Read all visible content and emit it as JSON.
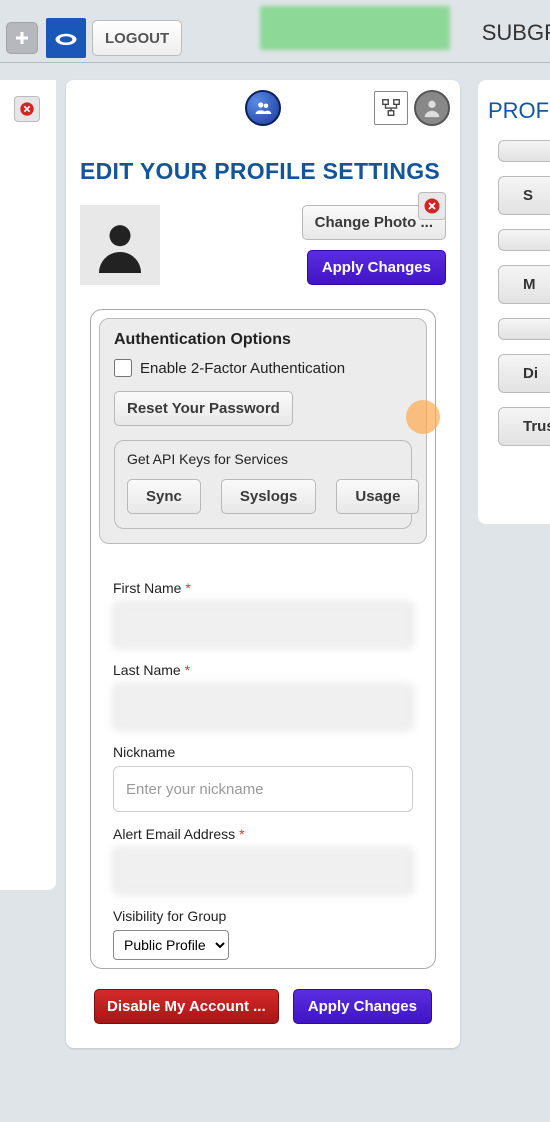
{
  "topbar": {
    "logout": "LOGOUT",
    "right_label": "SUBGR"
  },
  "settings": {
    "title": "EDIT YOUR PROFILE SETTINGS",
    "change_photo": "Change Photo ...",
    "apply_changes": "Apply Changes",
    "auth_title": "Authentication Options",
    "enable_2fa": "Enable 2-Factor Authentication",
    "reset_password": "Reset Your Password",
    "api_title": "Get API Keys for Services",
    "api_sync": "Sync",
    "api_syslogs": "Syslogs",
    "api_usage": "Usage"
  },
  "form": {
    "first_name_label": "First Name",
    "first_name_value": "",
    "last_name_label": "Last Name",
    "last_name_value": "",
    "nickname_label": "Nickname",
    "nickname_placeholder": "Enter your nickname",
    "nickname_value": "",
    "email_label": "Alert Email Address",
    "email_value": "",
    "visibility_label": "Visibility for Group",
    "visibility_value": "Public Profile",
    "required_marker": "*"
  },
  "bottom": {
    "disable": "Disable My Account ...",
    "apply": "Apply Changes"
  },
  "right": {
    "title": "PROF",
    "items": [
      "",
      "S",
      "",
      "M",
      "",
      "Di",
      "Trus"
    ]
  }
}
